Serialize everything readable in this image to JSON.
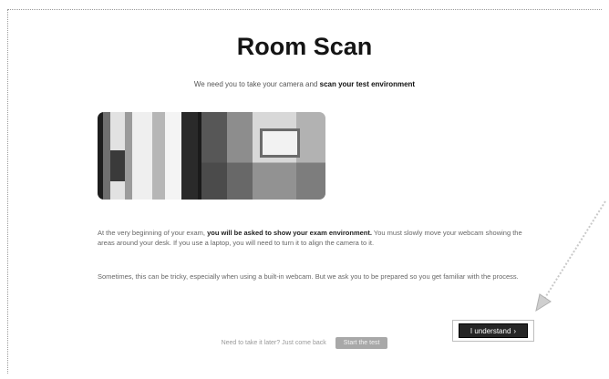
{
  "page": {
    "title": "Room Scan",
    "intro_text": "We need you to take your camera and",
    "intro_emphasis": "scan your test environment",
    "paragraph1_start": "At the very beginning of your exam,",
    "paragraph1_bold": "you will be asked to show your exam environment.",
    "paragraph1_rest": "You must slowly move your webcam showing the areas around your desk. If you use a laptop, you will need to turn it to align the camera to it.",
    "paragraph2": "Sometimes, this can be tricky, especially when using a built-in webcam. But we ask you to be prepared so you get familiar with the process."
  },
  "actions": {
    "understand_label": "I understand",
    "footer_text": "Need to take it later? Just come back",
    "footer_button_label": "Start the test"
  },
  "icons": {
    "chevron": "chevron-right-icon"
  },
  "colors": {
    "button_bg": "#262626",
    "footer_button_bg": "#a8a8a8"
  }
}
